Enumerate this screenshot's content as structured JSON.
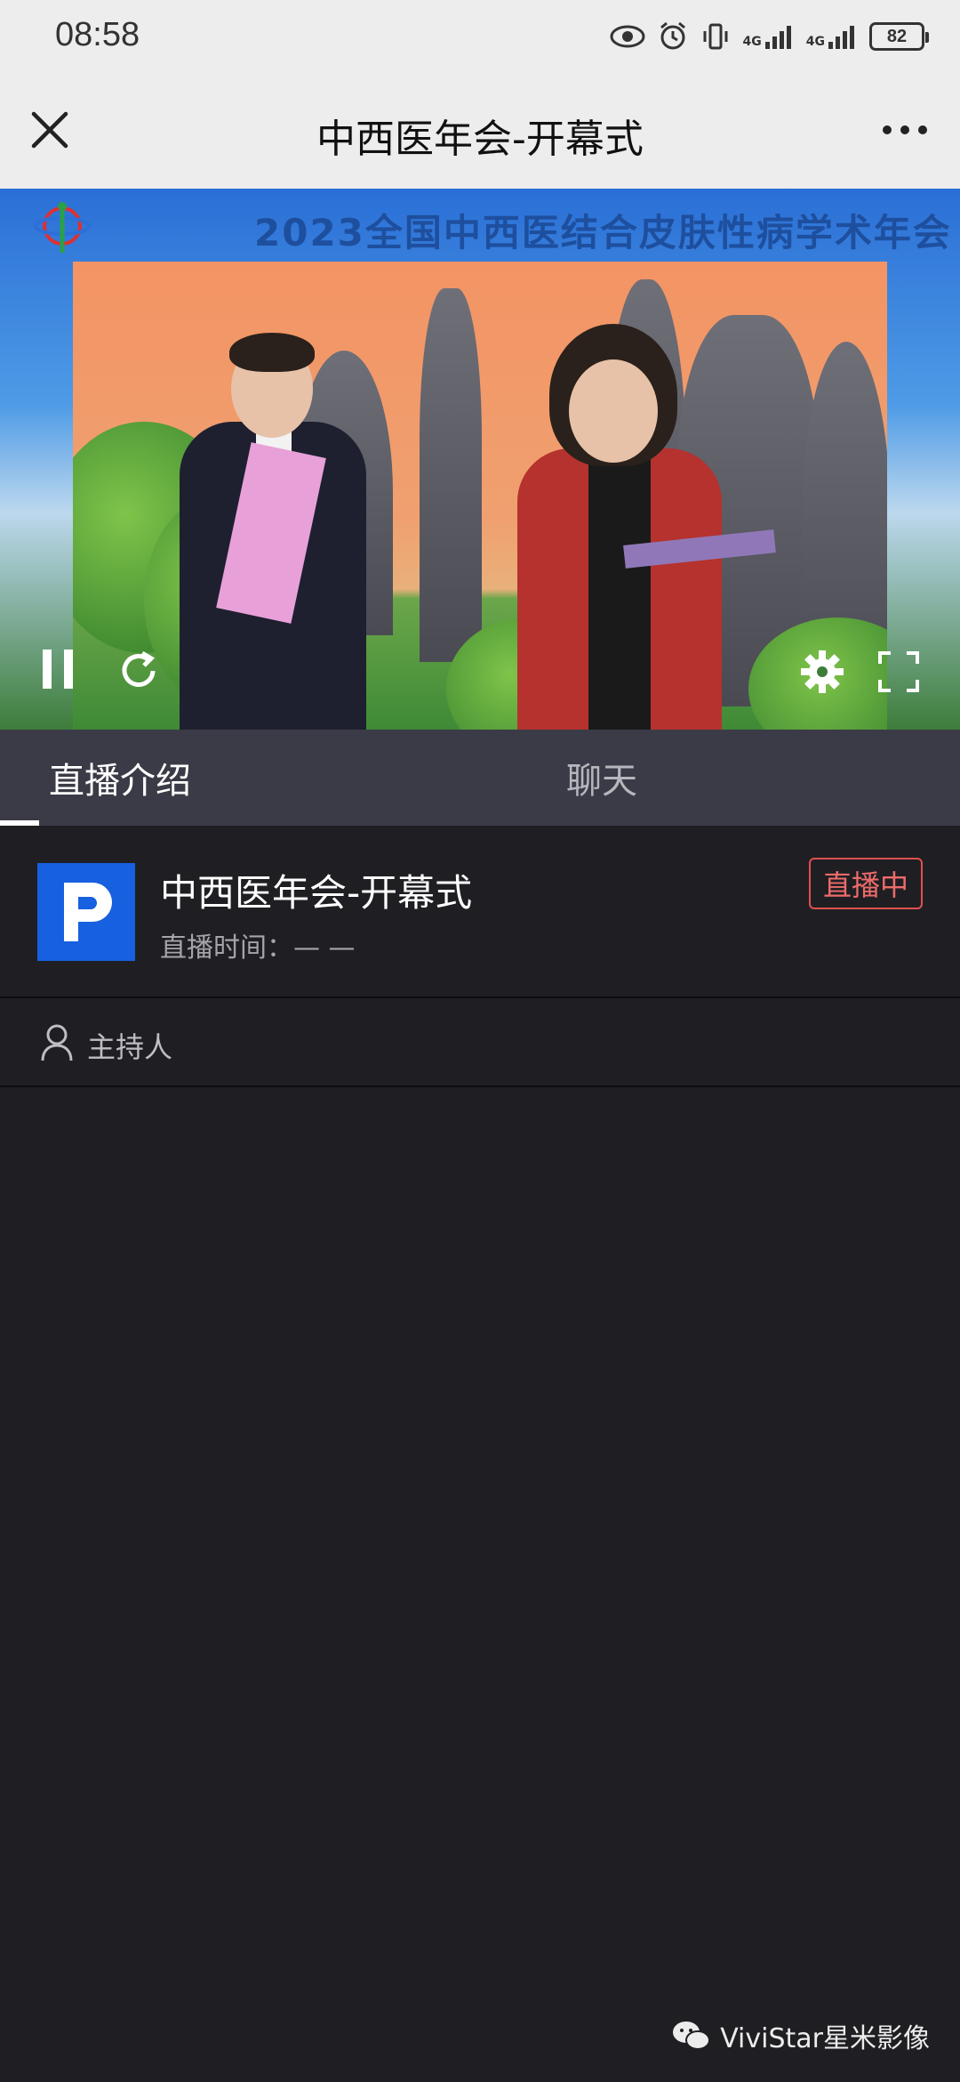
{
  "status_bar": {
    "time": "08:58",
    "battery": "82",
    "network_1": "4G",
    "network_2": "4G"
  },
  "nav": {
    "title": "中西医年会-开幕式",
    "close_icon": "close-icon",
    "more_icon": "more-icon"
  },
  "video": {
    "banner": "2023全国中西医结合皮肤性病学术年会",
    "controls": [
      "pause-icon",
      "refresh-icon",
      "gear-icon",
      "fullscreen-icon"
    ]
  },
  "tabs": [
    {
      "label": "直播介绍",
      "active": true
    },
    {
      "label": "聊天",
      "active": false
    }
  ],
  "info": {
    "title": "中西医年会-开幕式",
    "time_label": "直播时间：",
    "time_value": "— —",
    "status_badge": "直播中",
    "avatar_letter": "P"
  },
  "host": {
    "label": "主持人"
  },
  "watermark": {
    "text": "ViviStar星米影像"
  },
  "colors": {
    "accent_blue": "#1760e0",
    "live_red": "#ee6b6b",
    "tab_bg": "#3b3b47",
    "page_bg": "#1f1f23"
  }
}
